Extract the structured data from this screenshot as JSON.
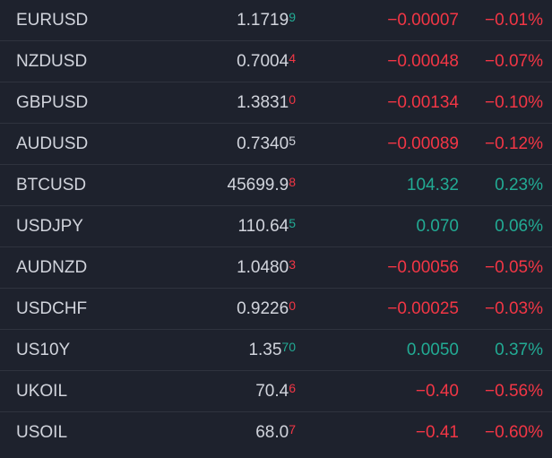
{
  "colors": {
    "background": "#1e222d",
    "divider": "#2f333e",
    "text": "#d1d4dc",
    "negative": "#f23645",
    "positive": "#22ab94"
  },
  "rows": [
    {
      "symbol": "EURUSD",
      "price_main": "1.1719",
      "price_tail": "9",
      "tail_dir": "pos",
      "change": "−0.00007",
      "pct": "−0.01%",
      "dir": "neg"
    },
    {
      "symbol": "NZDUSD",
      "price_main": "0.7004",
      "price_tail": "4",
      "tail_dir": "neg",
      "change": "−0.00048",
      "pct": "−0.07%",
      "dir": "neg"
    },
    {
      "symbol": "GBPUSD",
      "price_main": "1.3831",
      "price_tail": "0",
      "tail_dir": "neg",
      "change": "−0.00134",
      "pct": "−0.10%",
      "dir": "neg"
    },
    {
      "symbol": "AUDUSD",
      "price_main": "0.7340",
      "price_tail": "5",
      "tail_dir": "none",
      "change": "−0.00089",
      "pct": "−0.12%",
      "dir": "neg"
    },
    {
      "symbol": "BTCUSD",
      "price_main": "45699.9",
      "price_tail": "8",
      "tail_dir": "neg",
      "change": "104.32",
      "pct": "0.23%",
      "dir": "pos"
    },
    {
      "symbol": "USDJPY",
      "price_main": "110.64",
      "price_tail": "5",
      "tail_dir": "pos",
      "change": "0.070",
      "pct": "0.06%",
      "dir": "pos"
    },
    {
      "symbol": "AUDNZD",
      "price_main": "1.0480",
      "price_tail": "3",
      "tail_dir": "neg",
      "change": "−0.00056",
      "pct": "−0.05%",
      "dir": "neg"
    },
    {
      "symbol": "USDCHF",
      "price_main": "0.9226",
      "price_tail": "0",
      "tail_dir": "neg",
      "change": "−0.00025",
      "pct": "−0.03%",
      "dir": "neg"
    },
    {
      "symbol": "US10Y",
      "price_main": "1.35",
      "price_tail": "70",
      "tail_dir": "pos",
      "change": "0.0050",
      "pct": "0.37%",
      "dir": "pos"
    },
    {
      "symbol": "UKOIL",
      "price_main": "70.4",
      "price_tail": "6",
      "tail_dir": "neg",
      "change": "−0.40",
      "pct": "−0.56%",
      "dir": "neg"
    },
    {
      "symbol": "USOIL",
      "price_main": "68.0",
      "price_tail": "7",
      "tail_dir": "neg",
      "change": "−0.41",
      "pct": "−0.60%",
      "dir": "neg"
    }
  ]
}
